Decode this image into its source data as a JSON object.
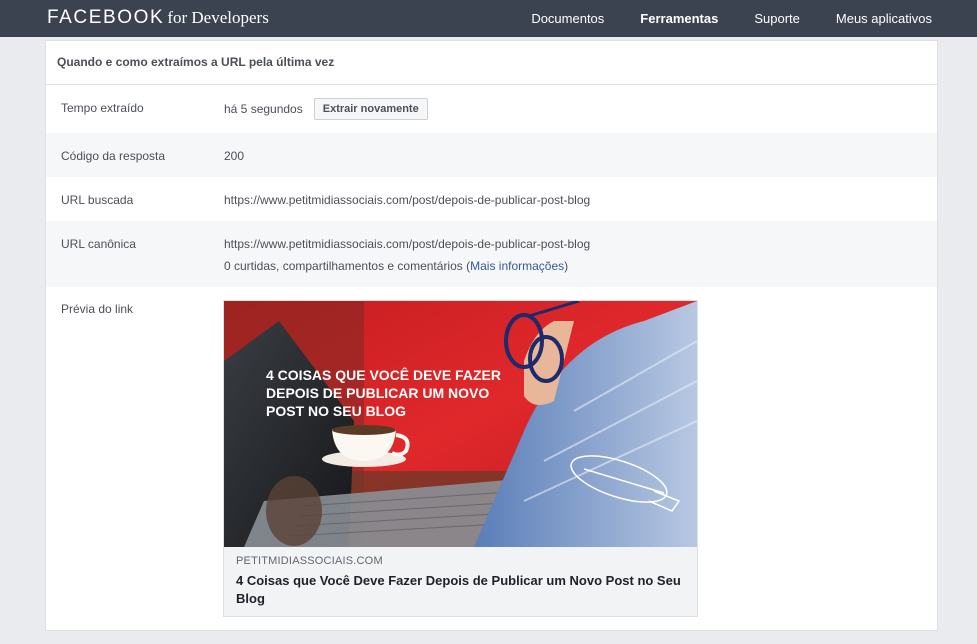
{
  "header": {
    "brand_main": "FACEBOOK",
    "brand_sub": "for Developers",
    "nav": [
      {
        "label": "Documentos",
        "active": false
      },
      {
        "label": "Ferramentas",
        "active": true
      },
      {
        "label": "Suporte",
        "active": false
      },
      {
        "label": "Meus aplicativos",
        "active": false
      }
    ]
  },
  "card": {
    "title": "Quando e como extraímos a URL pela última vez",
    "rows": {
      "scraped": {
        "label": "Tempo extraído",
        "value": "há 5 segundos",
        "button": "Extrair novamente"
      },
      "response": {
        "label": "Código da resposta",
        "value": "200"
      },
      "fetched": {
        "label": "URL buscada",
        "value": "https://www.petitmidiassociais.com/post/depois-de-publicar-post-blog"
      },
      "canonical": {
        "label": "URL canônica",
        "value": "https://www.petitmidiassociais.com/post/depois-de-publicar-post-blog",
        "stats_text": "0 curtidas, compartilhamentos e comentários (",
        "more_link": "Mais informações",
        "stats_close": ")"
      },
      "preview": {
        "label": "Prévia do link",
        "image_text_lines": [
          "4 COISAS QUE VOCÊ DEVE FAZER",
          "DEPOIS DE PUBLICAR UM NOVO",
          "POST NO SEU BLOG"
        ],
        "domain": "PETITMIDIASSOCIAIS.COM",
        "title": "4 Coisas que Você Deve Fazer Depois de Publicar um Novo Post no Seu Blog"
      }
    }
  },
  "colors": {
    "topbar": "#3b4350",
    "link": "#365899",
    "image_red": "#d8262a"
  }
}
